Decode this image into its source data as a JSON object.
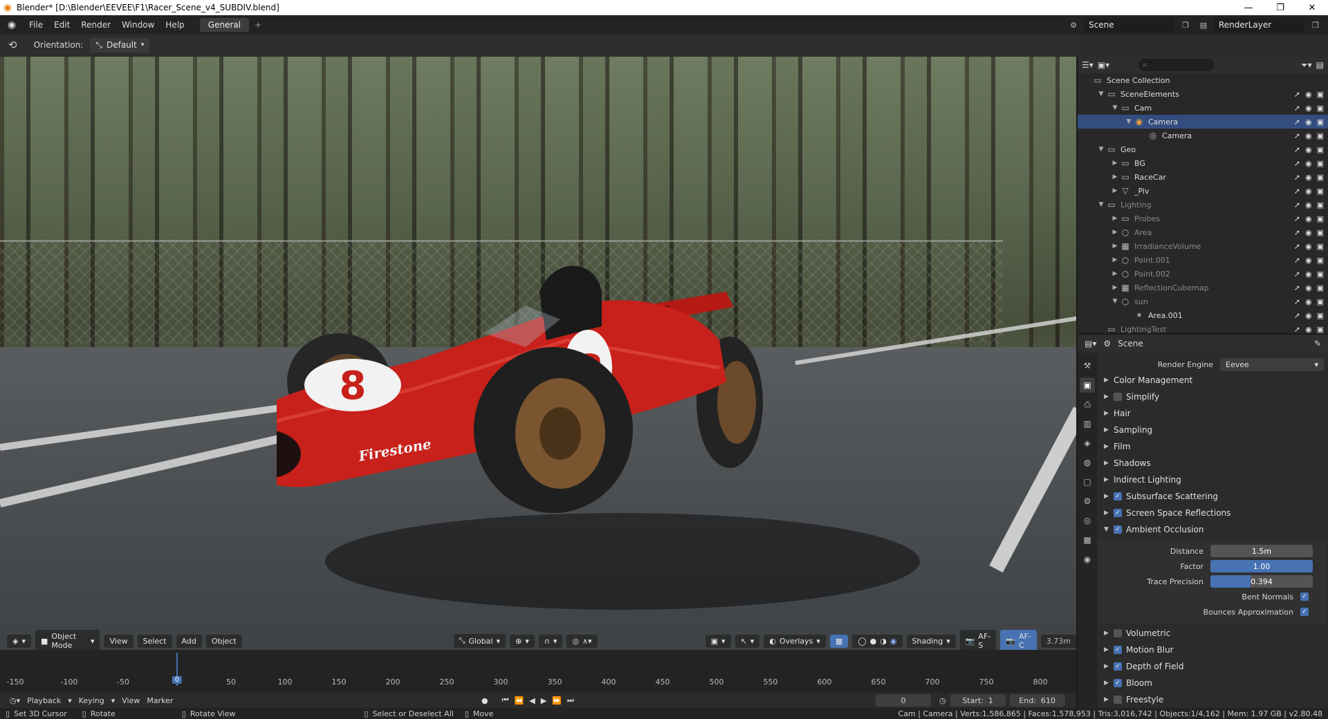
{
  "window": {
    "title": "Blender* [D:\\Blender\\EEVEE\\F1\\Racer_Scene_v4_SUBDIV.blend]",
    "min": "—",
    "max": "❐",
    "close": "✕"
  },
  "menu": {
    "items": [
      "File",
      "Edit",
      "Render",
      "Window",
      "Help"
    ],
    "workspace_tab": "General",
    "add": "+"
  },
  "topright": {
    "scene": "Scene",
    "render_layer": "RenderLayer"
  },
  "header": {
    "orientation_label": "Orientation:",
    "orientation_value": "Default"
  },
  "viewport": {
    "mode": "Object Mode",
    "menus": [
      "View",
      "Select",
      "Add",
      "Object"
    ],
    "transform": "Global",
    "overlays": "Overlays",
    "shading": "Shading",
    "af_s": "AF-S",
    "af_c": "AF-C",
    "distance_readout": "3.73m",
    "car_number": "8",
    "car_brand": "Firestone"
  },
  "timeline": {
    "ticks": [
      "-150",
      "-100",
      "-50",
      "0",
      "50",
      "100",
      "150",
      "200",
      "250",
      "300",
      "350",
      "400",
      "450",
      "500",
      "550",
      "600",
      "650",
      "700",
      "750",
      "800"
    ],
    "current_frame": "0"
  },
  "playbar": {
    "menus": [
      "Playback",
      "Keying",
      "View",
      "Marker"
    ],
    "frame": "0",
    "start_label": "Start:",
    "start": "1",
    "end_label": "End:",
    "end": "610"
  },
  "status": {
    "left": [
      "Set 3D Cursor",
      "Rotate",
      "Rotate View",
      "Select or Deselect All",
      "Move"
    ],
    "right": "Cam | Camera | Verts:1,586,865 | Faces:1,578,953 | Tris:3,016,742 | Objects:1/4,162 | Mem: 1.97 GB | v2.80.48"
  },
  "outliner": {
    "rows": [
      {
        "label": "Scene Collection",
        "depth": 0,
        "icon": "▭",
        "arrow": "",
        "dim": false,
        "sel": false
      },
      {
        "label": "SceneElements",
        "depth": 1,
        "icon": "▭",
        "arrow": "▼",
        "dim": false,
        "sel": false
      },
      {
        "label": "Cam",
        "depth": 2,
        "icon": "▭",
        "arrow": "▼",
        "dim": false,
        "sel": false
      },
      {
        "label": "Camera",
        "depth": 3,
        "icon": "◉",
        "arrow": "▼",
        "dim": false,
        "sel": true
      },
      {
        "label": "Camera",
        "depth": 4,
        "icon": "◎",
        "arrow": "",
        "dim": false,
        "sel": false
      },
      {
        "label": "Geo",
        "depth": 1,
        "icon": "▭",
        "arrow": "▼",
        "dim": false,
        "sel": false
      },
      {
        "label": "BG",
        "depth": 2,
        "icon": "▭",
        "arrow": "▶",
        "dim": false,
        "sel": false
      },
      {
        "label": "RaceCar",
        "depth": 2,
        "icon": "▭",
        "arrow": "▶",
        "dim": false,
        "sel": false
      },
      {
        "label": "_Piv",
        "depth": 2,
        "icon": "▽",
        "arrow": "▶",
        "dim": false,
        "sel": false
      },
      {
        "label": "Lighting",
        "depth": 1,
        "icon": "▭",
        "arrow": "▼",
        "dim": true,
        "sel": false
      },
      {
        "label": "Probes",
        "depth": 2,
        "icon": "▭",
        "arrow": "▶",
        "dim": true,
        "sel": false
      },
      {
        "label": "Area",
        "depth": 2,
        "icon": "○",
        "arrow": "▶",
        "dim": true,
        "sel": false
      },
      {
        "label": "IrradianceVolume",
        "depth": 2,
        "icon": "▦",
        "arrow": "▶",
        "dim": true,
        "sel": false
      },
      {
        "label": "Point.001",
        "depth": 2,
        "icon": "○",
        "arrow": "▶",
        "dim": true,
        "sel": false
      },
      {
        "label": "Point.002",
        "depth": 2,
        "icon": "○",
        "arrow": "▶",
        "dim": true,
        "sel": false
      },
      {
        "label": "ReflectionCubemap",
        "depth": 2,
        "icon": "▦",
        "arrow": "▶",
        "dim": true,
        "sel": false
      },
      {
        "label": "sun",
        "depth": 2,
        "icon": "○",
        "arrow": "▼",
        "dim": true,
        "sel": false
      },
      {
        "label": "Area.001",
        "depth": 3,
        "icon": "✶",
        "arrow": "",
        "dim": false,
        "sel": false
      },
      {
        "label": "LightingTest",
        "depth": 1,
        "icon": "▭",
        "arrow": "",
        "dim": true,
        "sel": false
      }
    ]
  },
  "properties": {
    "context": "Scene",
    "render_engine_label": "Render Engine",
    "render_engine": "Eevee",
    "panels": [
      {
        "label": "Color Management",
        "checkbox": null,
        "open": false
      },
      {
        "label": "Simplify",
        "checkbox": false,
        "open": false
      },
      {
        "label": "Hair",
        "checkbox": null,
        "open": false
      },
      {
        "label": "Sampling",
        "checkbox": null,
        "open": false
      },
      {
        "label": "Film",
        "checkbox": null,
        "open": false
      },
      {
        "label": "Shadows",
        "checkbox": null,
        "open": false
      },
      {
        "label": "Indirect Lighting",
        "checkbox": null,
        "open": false
      },
      {
        "label": "Subsurface Scattering",
        "checkbox": true,
        "open": false
      },
      {
        "label": "Screen Space Reflections",
        "checkbox": true,
        "open": false
      },
      {
        "label": "Ambient Occlusion",
        "checkbox": true,
        "open": true
      }
    ],
    "ao": {
      "distance_label": "Distance",
      "distance": "1.5m",
      "distance_fill": 0,
      "factor_label": "Factor",
      "factor": "1.00",
      "factor_fill": 1.0,
      "trace_label": "Trace Precision",
      "trace": "0.394",
      "trace_fill": 0.394,
      "bent_normals": "Bent Normals",
      "bounces": "Bounces Approximation"
    },
    "panels_after": [
      {
        "label": "Volumetric",
        "checkbox": false
      },
      {
        "label": "Motion Blur",
        "checkbox": true
      },
      {
        "label": "Depth of Field",
        "checkbox": true
      },
      {
        "label": "Bloom",
        "checkbox": true
      },
      {
        "label": "Freestyle",
        "checkbox": false
      }
    ]
  },
  "colors": {
    "accent": "#4772b3",
    "selection": "#334d80",
    "car_red": "#c8201a"
  }
}
